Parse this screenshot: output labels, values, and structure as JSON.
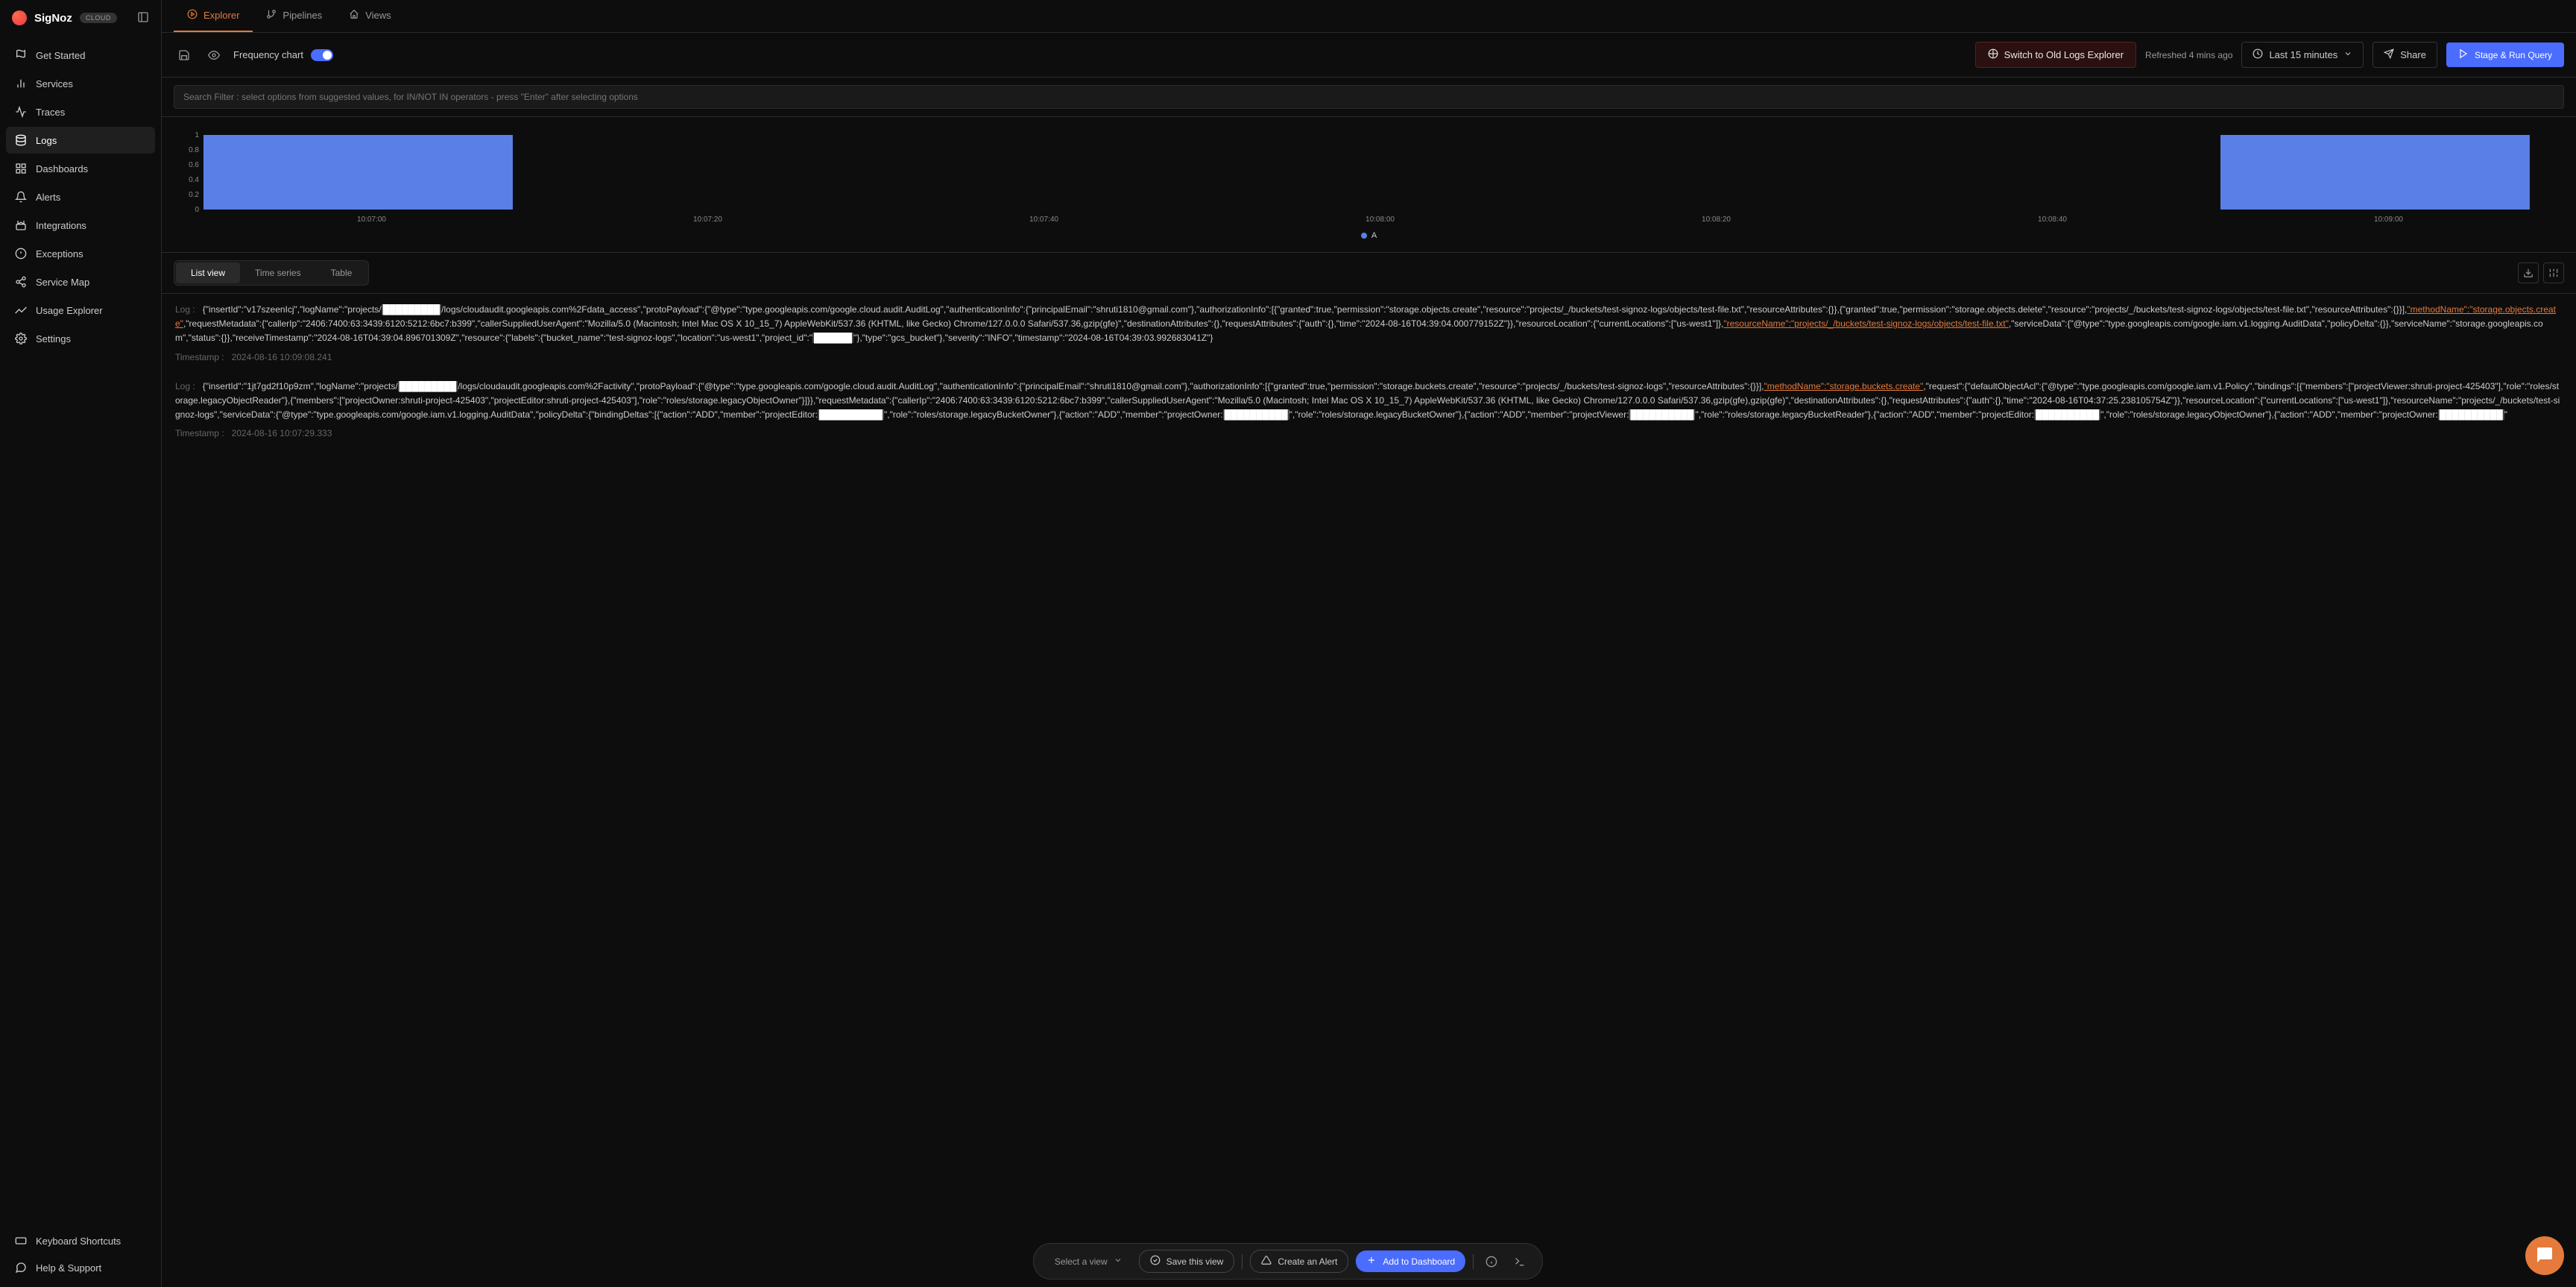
{
  "brand": {
    "name": "SigNoz",
    "badge": "CLOUD"
  },
  "nav": {
    "items": [
      {
        "label": "Get Started",
        "key": "get-started"
      },
      {
        "label": "Services",
        "key": "services"
      },
      {
        "label": "Traces",
        "key": "traces"
      },
      {
        "label": "Logs",
        "key": "logs"
      },
      {
        "label": "Dashboards",
        "key": "dashboards"
      },
      {
        "label": "Alerts",
        "key": "alerts"
      },
      {
        "label": "Integrations",
        "key": "integrations"
      },
      {
        "label": "Exceptions",
        "key": "exceptions"
      },
      {
        "label": "Service Map",
        "key": "service-map"
      },
      {
        "label": "Usage Explorer",
        "key": "usage-explorer"
      },
      {
        "label": "Settings",
        "key": "settings"
      }
    ],
    "bottom": [
      {
        "label": "Keyboard Shortcuts",
        "key": "keyboard"
      },
      {
        "label": "Help & Support",
        "key": "help"
      }
    ],
    "active": "logs"
  },
  "tabs": [
    {
      "label": "Explorer",
      "active": true
    },
    {
      "label": "Pipelines",
      "active": false
    },
    {
      "label": "Views",
      "active": false
    }
  ],
  "toolbar": {
    "freq_label": "Frequency chart",
    "switch_old": "Switch to Old Logs Explorer",
    "refreshed": "Refreshed 4 mins ago",
    "time_range": "Last 15 minutes",
    "share": "Share",
    "run": "Stage & Run Query"
  },
  "search": {
    "placeholder": "Search Filter : select options from suggested values, for IN/NOT IN operators - press \"Enter\" after selecting options"
  },
  "chart_data": {
    "type": "bar",
    "y_ticks": [
      0,
      0.2,
      0.4,
      0.6,
      0.8,
      1
    ],
    "x_ticks": [
      "10:07:00",
      "10:07:20",
      "10:07:40",
      "10:08:00",
      "10:08:20",
      "10:08:40",
      "10:09:00"
    ],
    "categories": [
      "10:07:00",
      "10:07:20",
      "10:07:40",
      "10:08:00",
      "10:08:20",
      "10:08:40",
      "10:09:00"
    ],
    "values": [
      1,
      0,
      0,
      0,
      0,
      0,
      1
    ],
    "series_color": "#5a80e8",
    "legend": "A",
    "ylim": [
      0,
      1
    ]
  },
  "view_switcher": {
    "list": "List view",
    "time_series": "Time series",
    "table": "Table",
    "active": "list"
  },
  "logs": [
    {
      "label": "Log :",
      "body": "{\"insertId\":\"v17szeenIcj\",\"logName\":\"projects/█████████/logs/cloudaudit.googleapis.com%2Fdata_access\",\"protoPayload\":{\"@type\":\"type.googleapis.com/google.cloud.audit.AuditLog\",\"authenticationInfo\":{\"principalEmail\":\"shruti1810@gmail.com\"},\"authorizationInfo\":[{\"granted\":true,\"permission\":\"storage.objects.create\",\"resource\":\"projects/_/buckets/test-signoz-logs/objects/test-file.txt\",\"resourceAttributes\":{}},{\"granted\":true,\"permission\":\"storage.objects.delete\",\"resource\":\"projects/_/buckets/test-signoz-logs/objects/test-file.txt\",\"resourceAttributes\":{}}],\"methodName\":\"storage.objects.create\",\"requestMetadata\":{\"callerIp\":\"2406:7400:63:3439:6120:5212:6bc7:b399\",\"callerSuppliedUserAgent\":\"Mozilla/5.0 (Macintosh; Intel Mac OS X 10_15_7) AppleWebKit/537.36 (KHTML, like Gecko) Chrome/127.0.0.0 Safari/537.36,gzip(gfe)\",\"destinationAttributes\":{},\"requestAttributes\":{\"auth\":{},\"time\":\"2024-08-16T04:39:04.000779152Z\"}},\"resourceLocation\":{\"currentLocations\":[\"us-west1\"]},\"resourceName\":\"projects/_/buckets/test-signoz-logs/objects/test-file.txt\",\"serviceData\":{\"@type\":\"type.googleapis.com/google.iam.v1.logging.AuditData\",\"policyDelta\":{}},\"serviceName\":\"storage.googleapis.com\",\"status\":{}},\"receiveTimestamp\":\"2024-08-16T04:39:04.896701309Z\",\"resource\":{\"labels\":{\"bucket_name\":\"test-signoz-logs\",\"location\":\"us-west1\",\"project_id\":\"██████\"},\"type\":\"gcs_bucket\"},\"severity\":\"INFO\",\"timestamp\":\"2024-08-16T04:39:03.992683041Z\"}",
      "method_highlight": "\"methodName\":\"storage.objects.create\"",
      "resource_highlight": "\"resourceName\":\"projects/_/buckets/test-signoz-logs/objects/test-file.txt\"",
      "timestamp_label": "Timestamp :",
      "timestamp": "2024-08-16 10:09:08.241"
    },
    {
      "label": "Log :",
      "body": "{\"insertId\":\"1jt7gd2f10p9zm\",\"logName\":\"projects/█████████/logs/cloudaudit.googleapis.com%2Factivity\",\"protoPayload\":{\"@type\":\"type.googleapis.com/google.cloud.audit.AuditLog\",\"authenticationInfo\":{\"principalEmail\":\"shruti1810@gmail.com\"},\"authorizationInfo\":[{\"granted\":true,\"permission\":\"storage.buckets.create\",\"resource\":\"projects/_/buckets/test-signoz-logs\",\"resourceAttributes\":{}}],\"methodName\":\"storage.buckets.create\",\"request\":{\"defaultObjectAcl\":{\"@type\":\"type.googleapis.com/google.iam.v1.Policy\",\"bindings\":[{\"members\":[\"projectViewer:shruti-project-425403\"],\"role\":\"roles/storage.legacyObjectReader\"},{\"members\":[\"projectOwner:shruti-project-425403\",\"projectEditor:shruti-project-425403\"],\"role\":\"roles/storage.legacyObjectOwner\"}]}},\"requestMetadata\":{\"callerIp\":\"2406:7400:63:3439:6120:5212:6bc7:b399\",\"callerSuppliedUserAgent\":\"Mozilla/5.0 (Macintosh; Intel Mac OS X 10_15_7) AppleWebKit/537.36 (KHTML, like Gecko) Chrome/127.0.0.0 Safari/537.36,gzip(gfe),gzip(gfe)\",\"destinationAttributes\":{},\"requestAttributes\":{\"auth\":{},\"time\":\"2024-08-16T04:37:25.238105754Z\"}},\"resourceLocation\":{\"currentLocations\":[\"us-west1\"]},\"resourceName\":\"projects/_/buckets/test-signoz-logs\",\"serviceData\":{\"@type\":\"type.googleapis.com/google.iam.v1.logging.AuditData\",\"policyDelta\":{\"bindingDeltas\":[{\"action\":\"ADD\",\"member\":\"projectEditor:██████████\",\"role\":\"roles/storage.legacyBucketOwner\"},{\"action\":\"ADD\",\"member\":\"projectOwner:██████████\",\"role\":\"roles/storage.legacyBucketOwner\"},{\"action\":\"ADD\",\"member\":\"projectViewer:██████████\",\"role\":\"roles/storage.legacyBucketReader\"},{\"action\":\"ADD\",\"member\":\"projectEditor:██████████\",\"role\":\"roles/storage.legacyObjectOwner\"},{\"action\":\"ADD\",\"member\":\"projectOwner:██████████\"",
      "method_highlight": "\"methodName\":\"storage.buckets.create\"",
      "timestamp_label": "Timestamp :",
      "timestamp": "2024-08-16 10:07:29.333"
    }
  ],
  "bottom_bar": {
    "select_view": "Select a view",
    "save_view": "Save this view",
    "create_alert": "Create an Alert",
    "add_dashboard": "Add to Dashboard"
  }
}
